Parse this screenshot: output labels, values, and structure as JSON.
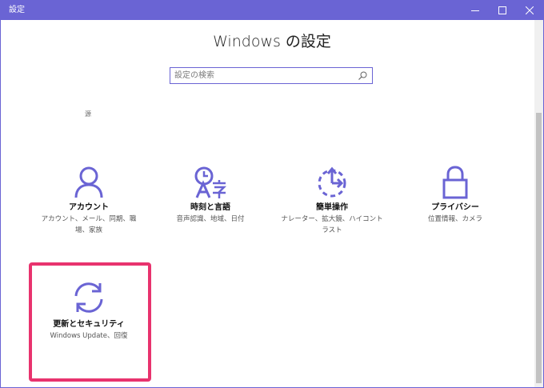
{
  "window": {
    "title": "設定",
    "buttons": [
      "minimize",
      "maximize",
      "close"
    ]
  },
  "page": {
    "title": "Windows の設定"
  },
  "search": {
    "placeholder": "設定の検索",
    "value": ""
  },
  "stray_text": "源",
  "tiles": [
    {
      "label": "アカウント",
      "description": "アカウント、メール、同期、職場、家族",
      "icon": "person-icon"
    },
    {
      "label": "時刻と言語",
      "description": "音声認識、地域、日付",
      "icon": "time-language-icon"
    },
    {
      "label": "簡単操作",
      "description": "ナレーター、拡大鏡、ハイコントラスト",
      "icon": "ease-of-access-icon"
    },
    {
      "label": "プライバシー",
      "description": "位置情報、カメラ",
      "icon": "lock-icon"
    },
    {
      "label": "更新とセキュリティ",
      "description": "Windows Update、回復",
      "icon": "sync-icon"
    }
  ],
  "colors": {
    "accent": "#6a64d4",
    "highlight": "#e8336e"
  }
}
